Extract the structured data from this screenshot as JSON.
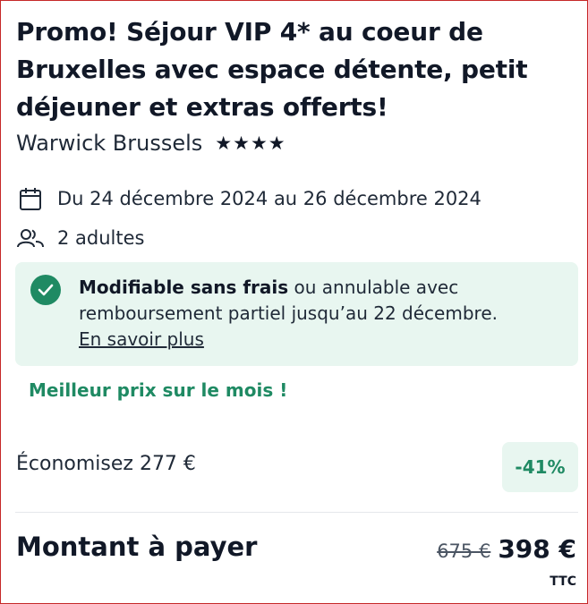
{
  "offer": {
    "title": "Promo! Séjour VIP 4* au coeur de Bruxelles avec espace détente, petit déjeuner et extras offerts!",
    "hotel_name": "Warwick Brussels",
    "star_rating": 4,
    "stars": [
      "★",
      "★",
      "★",
      "★"
    ]
  },
  "details": {
    "dates": "Du 24 décembre 2024 au 26 décembre 2024",
    "guests": "2 adultes",
    "calendar_icon": "calendar-icon",
    "guests_icon": "people-icon"
  },
  "cancellation": {
    "bold_text": "Modifiable sans frais",
    "text": " ou annulable avec remboursement partiel jusqu’au 22 décembre.",
    "link_text": "En savoir plus",
    "icon": "check-circle-icon"
  },
  "promo": {
    "best_price": "Meilleur prix sur le mois !"
  },
  "pricing": {
    "savings": "Économisez 277 €",
    "discount_badge": "-41%",
    "total_label": "Montant à payer",
    "old_price": "675 €",
    "new_price": "398 €",
    "tax_note": "TTC"
  },
  "colors": {
    "accent_green": "#1f8a63",
    "notice_bg": "#e8f6f0",
    "border": "#c62828",
    "text": "#111827"
  }
}
